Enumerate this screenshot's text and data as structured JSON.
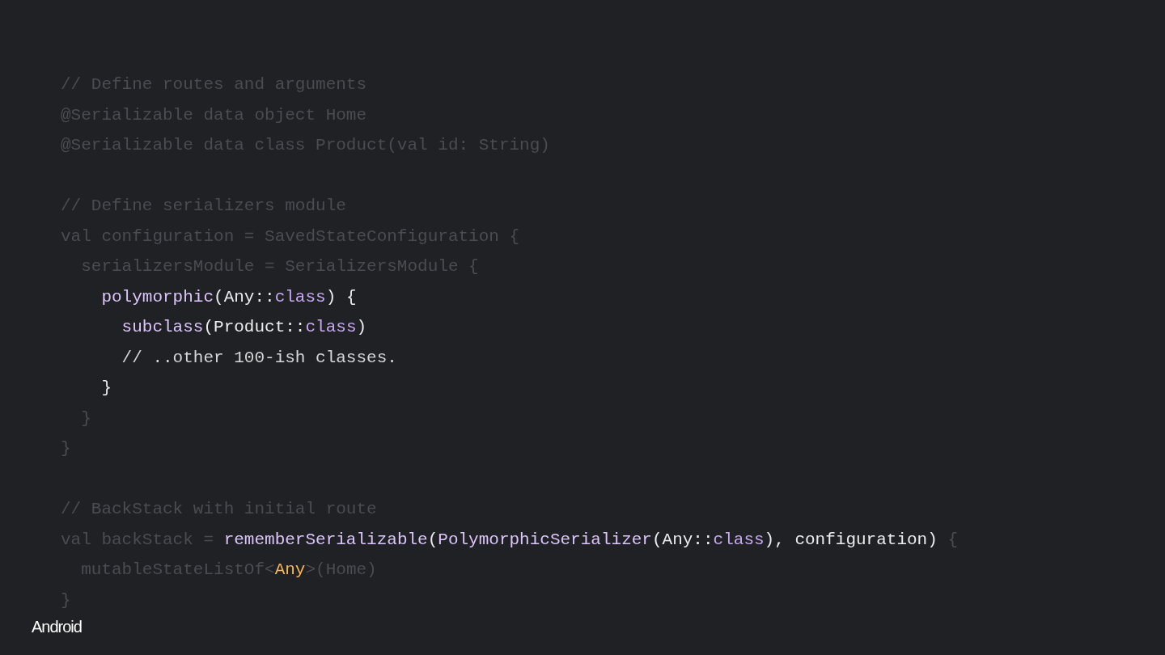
{
  "code_lines": [
    {
      "kind": "code",
      "tokens": [
        {
          "text": "// Define routes and arguments",
          "kind": "dim"
        }
      ]
    },
    {
      "kind": "code",
      "tokens": [
        {
          "text": "@Serializable data object Home",
          "kind": "dim"
        }
      ]
    },
    {
      "kind": "code",
      "tokens": [
        {
          "text": "@Serializable data class Product(val id: String)",
          "kind": "dim"
        }
      ]
    },
    {
      "kind": "blank"
    },
    {
      "kind": "code",
      "tokens": [
        {
          "text": "// Define serializers module",
          "kind": "dim"
        }
      ]
    },
    {
      "kind": "code",
      "tokens": [
        {
          "text": "val configuration = SavedStateConfiguration {",
          "kind": "dim"
        }
      ]
    },
    {
      "kind": "code",
      "tokens": [
        {
          "text": "  serializersModule = SerializersModule {",
          "kind": "dim"
        }
      ]
    },
    {
      "kind": "code",
      "tokens": [
        {
          "text": "    polymorphic",
          "kind": "function"
        },
        {
          "text": "(Any::",
          "kind": "plain"
        },
        {
          "text": "class",
          "kind": "keyword"
        },
        {
          "text": ") {",
          "kind": "plain"
        }
      ]
    },
    {
      "kind": "code",
      "tokens": [
        {
          "text": "      subclass",
          "kind": "function"
        },
        {
          "text": "(Product::",
          "kind": "plain"
        },
        {
          "text": "class",
          "kind": "keyword"
        },
        {
          "text": ")",
          "kind": "plain"
        }
      ]
    },
    {
      "kind": "code",
      "tokens": [
        {
          "text": "      // ..other 100-ish classes.",
          "kind": "comment"
        }
      ]
    },
    {
      "kind": "code",
      "tokens": [
        {
          "text": "    }",
          "kind": "plain"
        }
      ]
    },
    {
      "kind": "code",
      "tokens": [
        {
          "text": "  }",
          "kind": "dim"
        }
      ]
    },
    {
      "kind": "code",
      "tokens": [
        {
          "text": "}",
          "kind": "dim"
        }
      ]
    },
    {
      "kind": "blank"
    },
    {
      "kind": "code",
      "tokens": [
        {
          "text": "// BackStack with initial route",
          "kind": "dim"
        }
      ]
    },
    {
      "kind": "code",
      "tokens": [
        {
          "text": "val backStack = ",
          "kind": "dim"
        },
        {
          "text": "rememberSerializable",
          "kind": "function"
        },
        {
          "text": "(",
          "kind": "plain"
        },
        {
          "text": "PolymorphicSerializer",
          "kind": "function"
        },
        {
          "text": "(Any::",
          "kind": "plain"
        },
        {
          "text": "class",
          "kind": "keyword"
        },
        {
          "text": "), configuration) ",
          "kind": "plain"
        },
        {
          "text": "{",
          "kind": "dim"
        }
      ]
    },
    {
      "kind": "code",
      "tokens": [
        {
          "text": "  mutableStateListOf<",
          "kind": "dim"
        },
        {
          "text": "Any",
          "kind": "type"
        },
        {
          "text": ">(Home)",
          "kind": "dim"
        }
      ]
    },
    {
      "kind": "code",
      "tokens": [
        {
          "text": "}",
          "kind": "dim"
        }
      ]
    }
  ],
  "footer": {
    "brand": "Android"
  }
}
